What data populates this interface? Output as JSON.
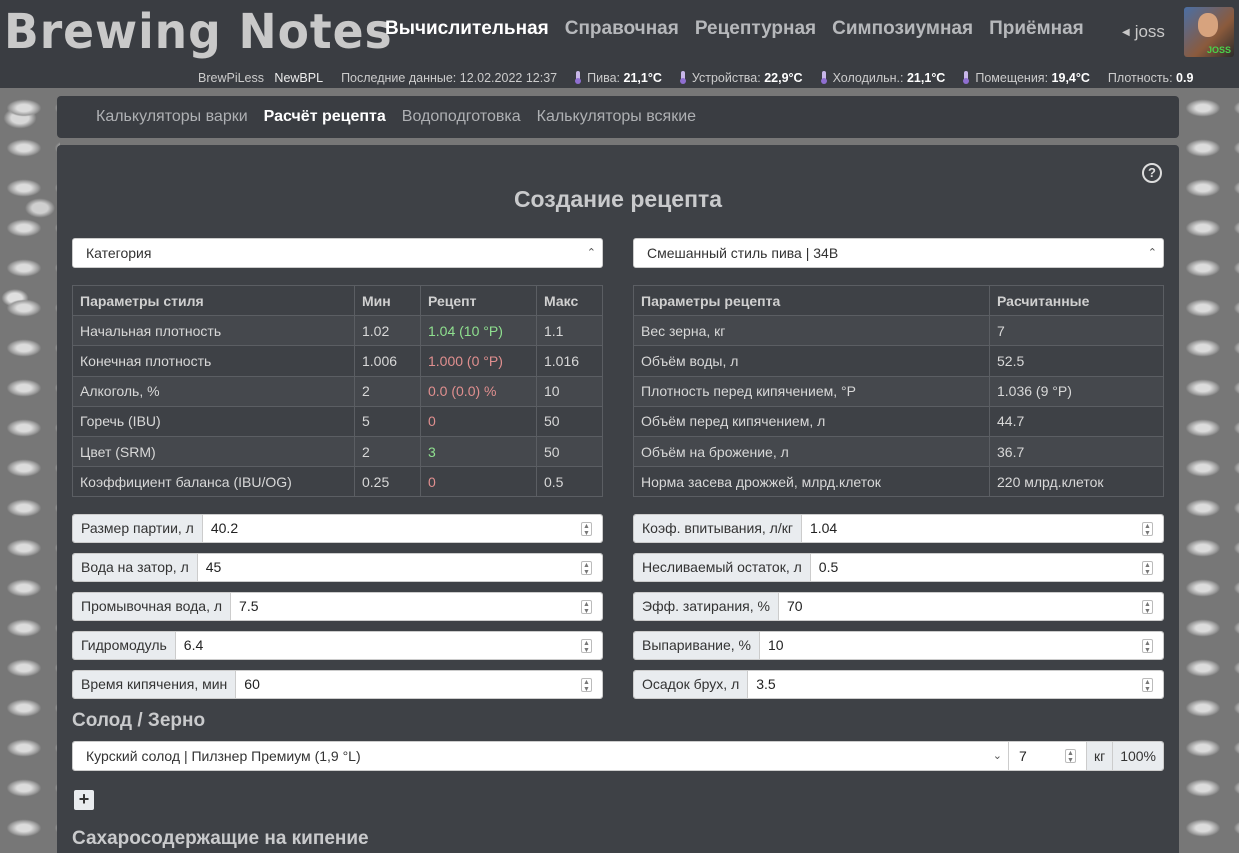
{
  "app": {
    "logo": "Brewing Notes"
  },
  "nav": {
    "items": [
      "Вычислительная",
      "Справочная",
      "Рецептурная",
      "Симпозиумная",
      "Приёмная"
    ],
    "active": 0
  },
  "user": {
    "name": "joss",
    "avatar_tag": "JOSS"
  },
  "status": {
    "device": "BrewPiLess",
    "device_name": "NewBPL",
    "last_label": "Последние данные:",
    "last_value": "12.02.2022 12:37",
    "beer_label": "Пива:",
    "beer_value": "21,1°C",
    "device_label": "Устройства:",
    "device_value": "22,9°C",
    "fridge_label": "Холодильн.:",
    "fridge_value": "21,1°C",
    "room_label": "Помещения:",
    "room_value": "19,4°C",
    "gravity_label": "Плотность:",
    "gravity_value": "0.9"
  },
  "subnav": {
    "items": [
      "Калькуляторы варки",
      "Расчёт рецепта",
      "Водоподготовка",
      "Калькуляторы всякие"
    ],
    "active": 1
  },
  "page": {
    "title": "Создание рецепта",
    "help": "?",
    "category_select": "Категория",
    "style_select": "Смешанный стиль пива | 34B"
  },
  "style_table": {
    "headers": [
      "Параметры стиля",
      "Мин",
      "Рецепт",
      "Макс"
    ],
    "rows": [
      [
        "Начальная плотность",
        "1.02",
        "1.04 (10 °P)",
        "1.1"
      ],
      [
        "Конечная плотность",
        "1.006",
        "1.000 (0 °P)",
        "1.016"
      ],
      [
        "Алкоголь, %",
        "2",
        "0.0 (0.0) %",
        "10"
      ],
      [
        "Горечь (IBU)",
        "5",
        "0",
        "50"
      ],
      [
        "Цвет (SRM)",
        "2",
        "3",
        "50"
      ],
      [
        "Коэффициент баланса (IBU/OG)",
        "0.25",
        "0",
        "0.5"
      ]
    ],
    "recipe_status": [
      "ok",
      "bad",
      "bad",
      "bad",
      "ok",
      "bad"
    ],
    "colors": {
      "ok": "#8fe08f",
      "bad": "#e08f8f"
    }
  },
  "recipe_table": {
    "headers": [
      "Параметры рецепта",
      "Расчитанные"
    ],
    "rows": [
      [
        "Вес зерна, кг",
        "7"
      ],
      [
        "Объём воды, л",
        "52.5"
      ],
      [
        "Плотность перед кипячением, °P",
        "1.036 (9 °P)"
      ],
      [
        "Объём перед кипячением, л",
        "44.7"
      ],
      [
        "Объём на брожение, л",
        "36.7"
      ],
      [
        "Норма засева дрожжей, млрд.клеток",
        "220 млрд.клеток"
      ]
    ]
  },
  "inputs_left": [
    {
      "label": "Размер партии, л",
      "value": "40.2"
    },
    {
      "label": "Вода на затор, л",
      "value": "45"
    },
    {
      "label": "Промывочная вода, л",
      "value": "7.5"
    },
    {
      "label": "Гидромодуль",
      "value": "6.4"
    },
    {
      "label": "Время кипячения, мин",
      "value": "60"
    }
  ],
  "inputs_right": [
    {
      "label": "Коэф. впитывания, л/кг",
      "value": "1.04"
    },
    {
      "label": "Несливаемый остаток, л",
      "value": "0.5"
    },
    {
      "label": "Эфф. затирания, %",
      "value": "70"
    },
    {
      "label": "Выпаривание, %",
      "value": "10"
    },
    {
      "label": "Осадок брух, л",
      "value": "3.5"
    }
  ],
  "grain": {
    "section_title": "Солод / Зерно",
    "selected": "Курский солод | Пилзнер Премиум (1,9 °L)",
    "qty": "7",
    "unit": "кг",
    "pct": "100%",
    "add": "+"
  },
  "sugars": {
    "section_title": "Сахаросодержащие на кипение"
  }
}
